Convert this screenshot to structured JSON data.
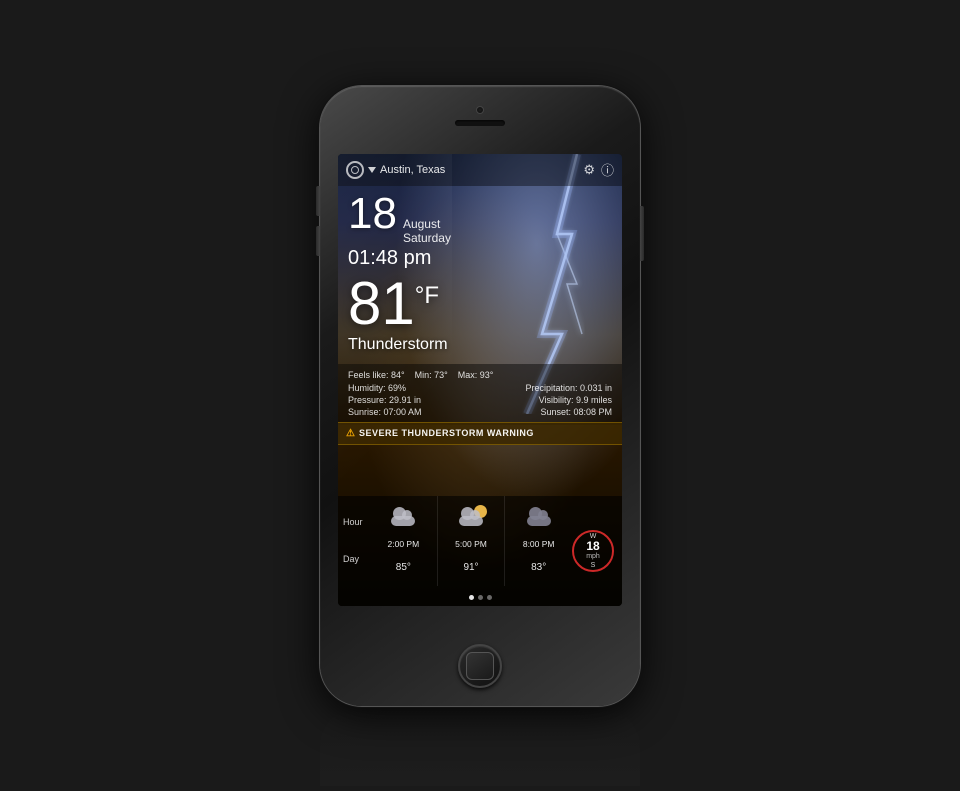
{
  "phone": {
    "screen": {
      "topBar": {
        "location": "Austin, Texas",
        "gearIcon": "⚙",
        "infoIcon": "ⓘ"
      },
      "datetime": {
        "dayNumber": "18",
        "month": "August",
        "dayName": "Saturday",
        "time": "01:48 pm"
      },
      "weather": {
        "temperature": "81",
        "unit": "°F",
        "condition": "Thunderstorm",
        "feelsLike": "Feels like: 84°",
        "minTemp": "Min: 73°",
        "maxTemp": "Max: 93°",
        "humidity": "Humidity: 69%",
        "precipitation": "Precipitation: 0.031 in",
        "pressure": "Pressure: 29.91 in",
        "visibility": "Visibility: 9.9 miles",
        "sunrise": "Sunrise: 07:00 AM",
        "sunset": "Sunset: 08:08 PM"
      },
      "warning": "⚠ SEVERE THUNDERSTORM WARNING",
      "forecast": {
        "labels": {
          "hour": "Hour",
          "day": "Day"
        },
        "items": [
          {
            "time": "2:00 PM",
            "temp": "85°",
            "icon": "cloud"
          },
          {
            "time": "5:00 PM",
            "temp": "91°",
            "icon": "cloud-sun"
          },
          {
            "time": "8:00 PM",
            "temp": "83°",
            "icon": "cloud-dark"
          }
        ],
        "wind": {
          "speed": "18",
          "unit": "mph",
          "direction": "S"
        },
        "dots": [
          true,
          false,
          false
        ]
      }
    }
  }
}
